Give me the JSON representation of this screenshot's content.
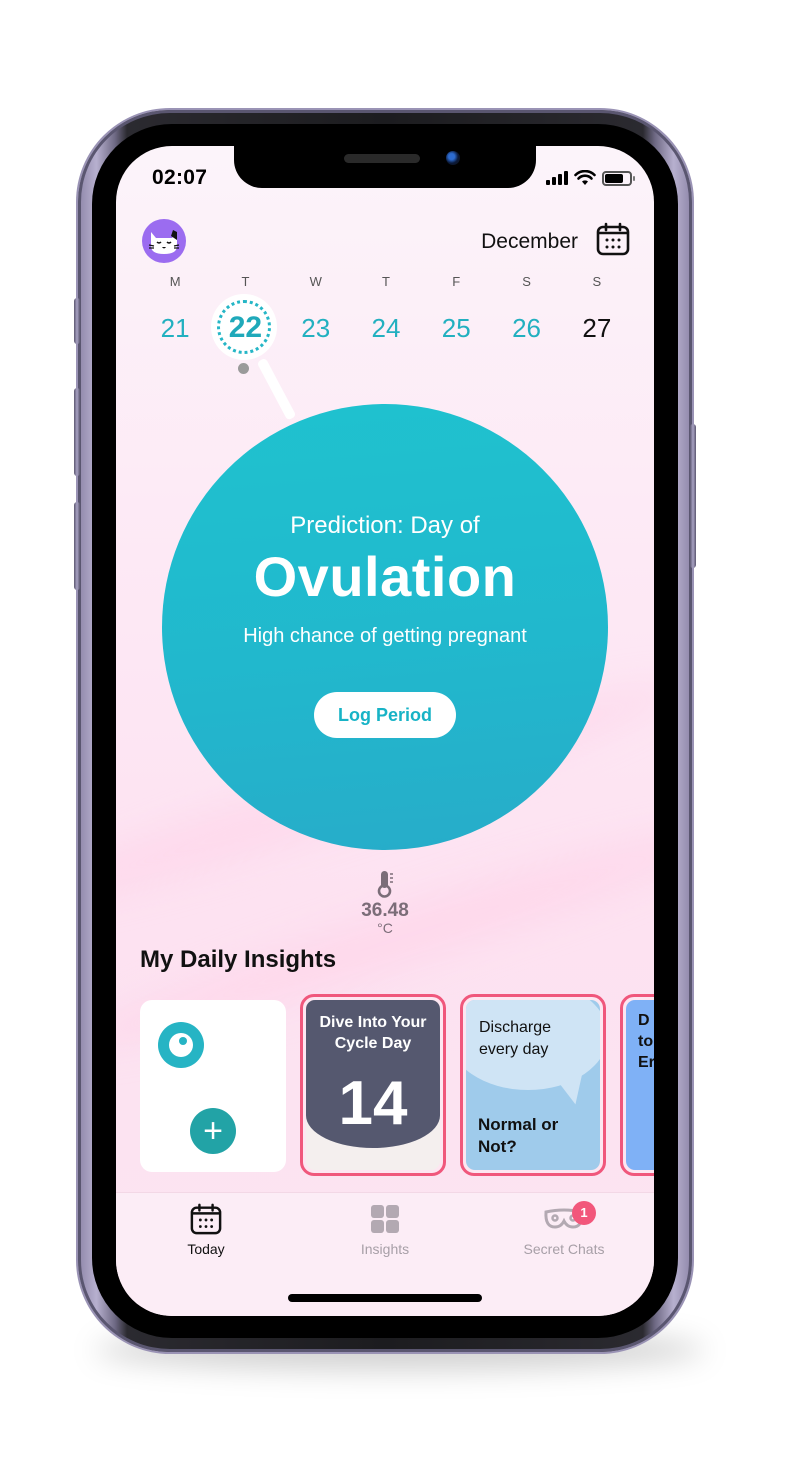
{
  "status_bar": {
    "time": "02:07",
    "battery_level": 0.75
  },
  "header": {
    "avatar": "cat-avatar",
    "month": "December",
    "calendar_icon": "calendar-icon"
  },
  "week": {
    "days": [
      {
        "dow": "M",
        "date": "21",
        "state": "past"
      },
      {
        "dow": "T",
        "date": "22",
        "state": "today"
      },
      {
        "dow": "W",
        "date": "23",
        "state": "predicted"
      },
      {
        "dow": "T",
        "date": "24",
        "state": "predicted"
      },
      {
        "dow": "F",
        "date": "25",
        "state": "predicted"
      },
      {
        "dow": "S",
        "date": "26",
        "state": "predicted"
      },
      {
        "dow": "S",
        "date": "27",
        "state": "future"
      }
    ]
  },
  "prediction": {
    "label": "Prediction: Day of",
    "title": "Ovulation",
    "subtitle": "High chance of getting pregnant",
    "button": "Log Period"
  },
  "temperature": {
    "icon": "thermometer-icon",
    "value": "36.48",
    "unit": "°C"
  },
  "insights": {
    "title": "My Daily Insights",
    "cards": [
      {
        "type": "add-log",
        "icon": "plus-icon"
      },
      {
        "type": "story",
        "title": "Dive Into Your Cycle Day",
        "number": "14"
      },
      {
        "type": "story",
        "line1": "Discharge every day",
        "line2": "Normal or Not?"
      },
      {
        "type": "story",
        "partial_text": "D\nto\nEr"
      }
    ]
  },
  "tabbar": {
    "tabs": [
      {
        "label": "Today",
        "icon": "calendar-icon",
        "active": true
      },
      {
        "label": "Insights",
        "icon": "grid-icon",
        "active": false
      },
      {
        "label": "Secret Chats",
        "icon": "mask-icon",
        "active": false,
        "badge": "1"
      }
    ]
  },
  "colors": {
    "accent": "#22B6C8",
    "badge": "#F2577B",
    "story_border": "#F0577C",
    "avatar_bg": "#9B6CF0",
    "cycle_card": "#55586F",
    "discharge_card": "#9FCBEB"
  }
}
